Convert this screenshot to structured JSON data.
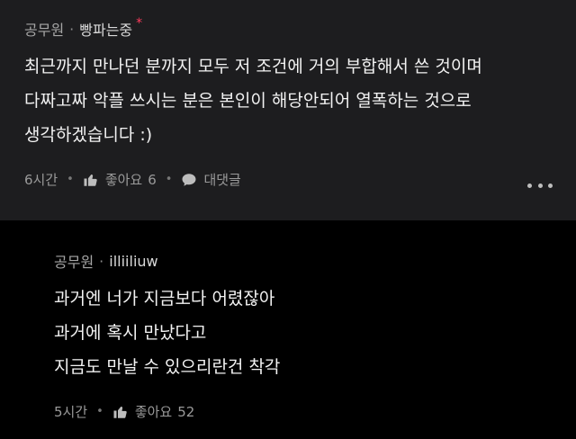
{
  "top_comment": {
    "board": "공무원",
    "nickname": "빵파는중",
    "best_mark": "*",
    "lines": [
      "최근까지 만나던 분까지 모두 저 조건에 거의 부합해서 쓴 것이며",
      "다짜고짜 악플 쓰시는 분은 본인이 해당안되어 열폭하는 것으로",
      "생각하겠습니다 :)"
    ],
    "time": "6시간",
    "like_label": "좋아요",
    "like_count": "6",
    "reply_label": "대댓글"
  },
  "reply_comment": {
    "board": "공무원",
    "nickname": "illiiliuw",
    "lines": [
      "과거엔 너가 지금보다 어렸잖아",
      "과거에 혹시 만났다고",
      "지금도 만날 수 있으리란건 착각"
    ],
    "time": "5시간",
    "like_label": "좋아요",
    "like_count": "52"
  },
  "icons": {
    "like": "thumbs-up-icon",
    "reply": "speech-bubble-icon",
    "more": "more-horizontal-icon"
  },
  "colors": {
    "top_background": "#1d1d1f",
    "reply_background": "#000000",
    "best_accent": "#ff3b5c"
  }
}
